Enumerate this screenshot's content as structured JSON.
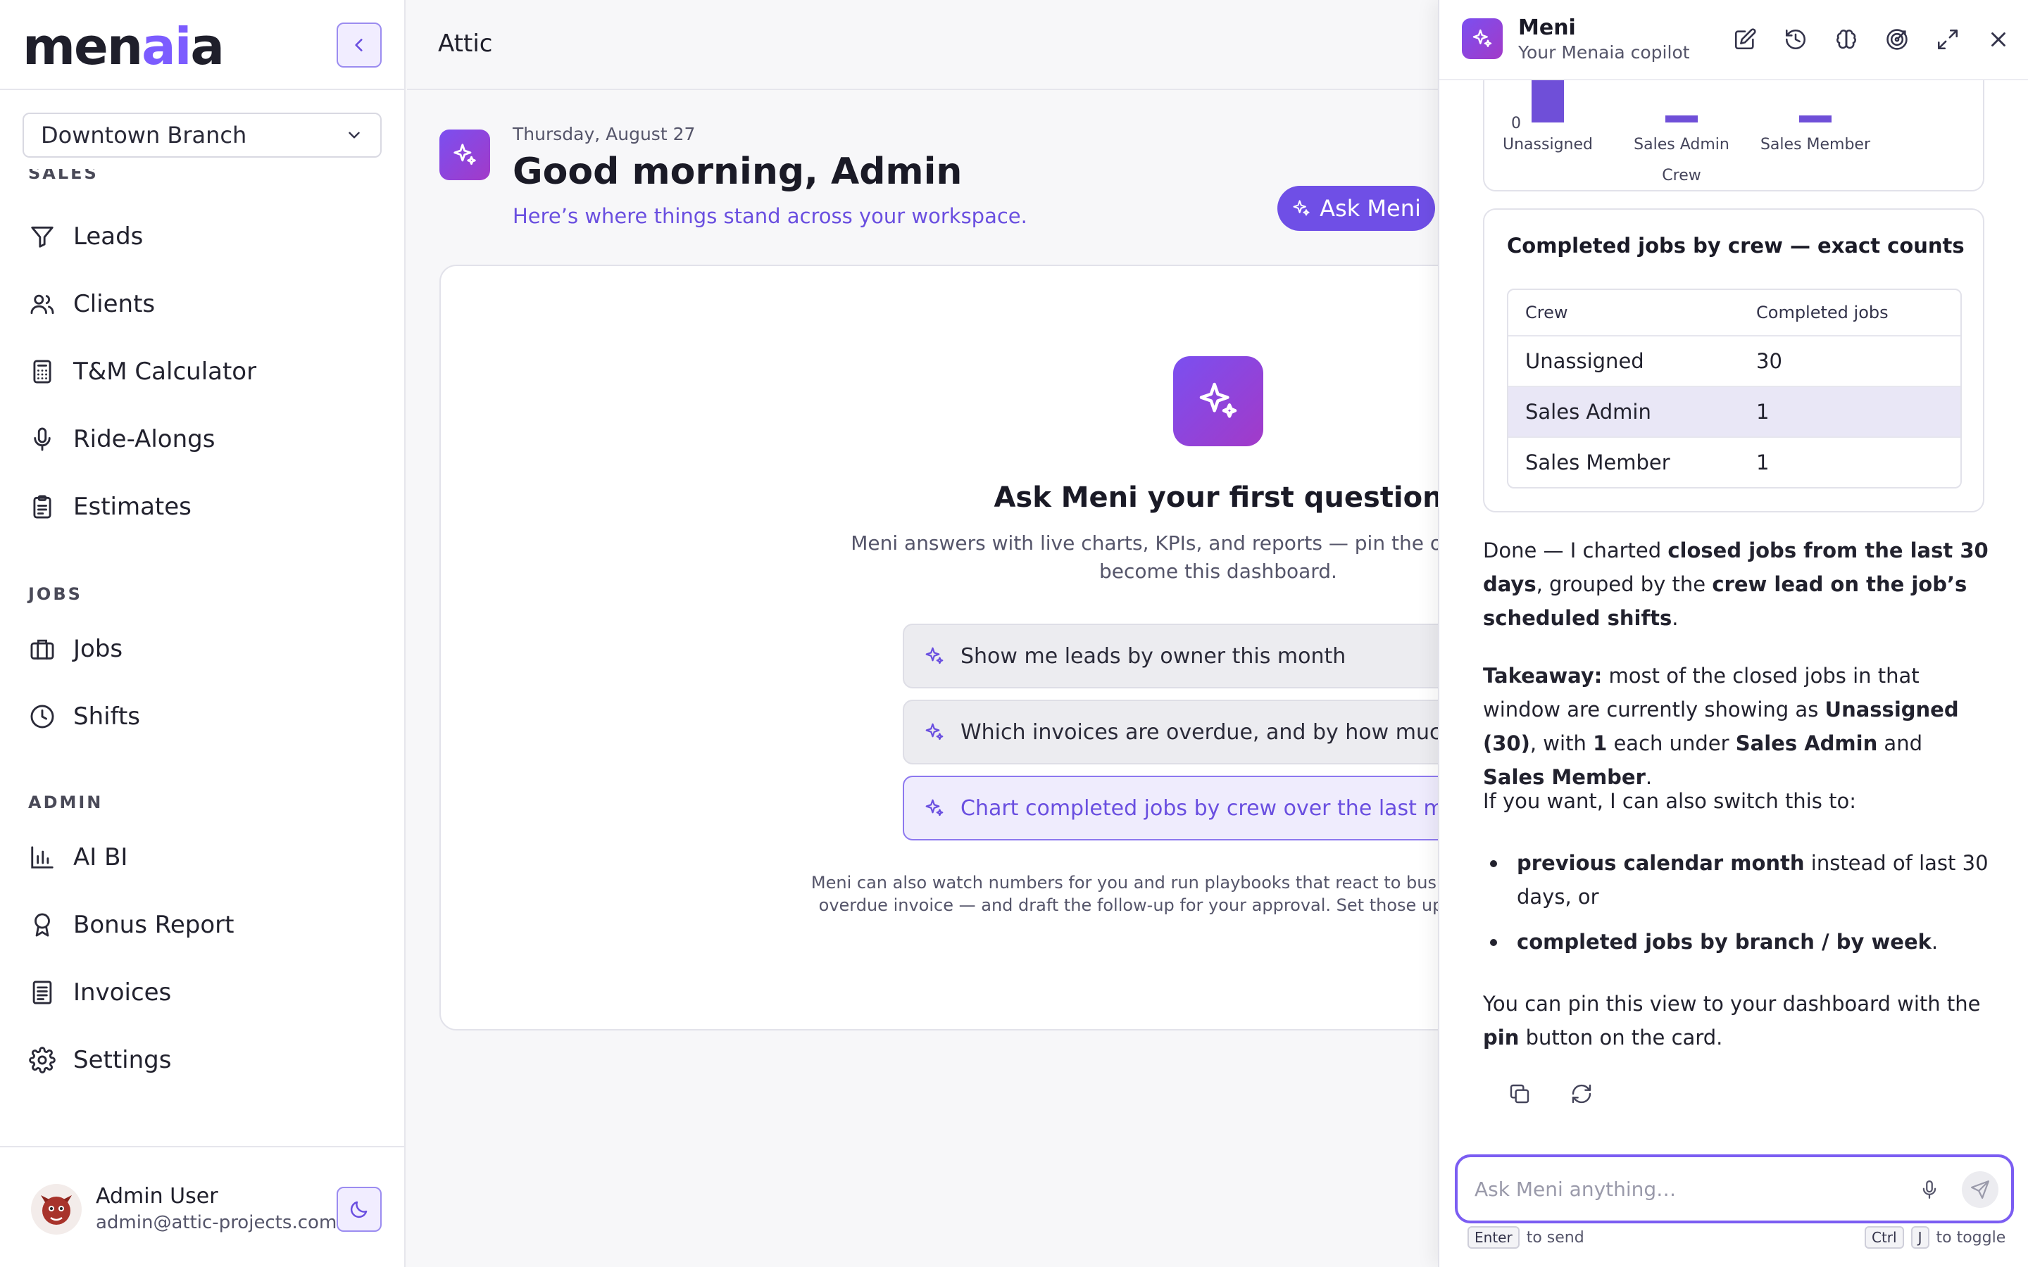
{
  "sidebar": {
    "logo_prefix": "men",
    "logo_accent": "ai",
    "logo_suffix": "a",
    "branch": "Downtown Branch",
    "sections": {
      "sales": "SALES",
      "jobs": "JOBS",
      "admin": "ADMIN"
    },
    "items": {
      "leads": "Leads",
      "clients": "Clients",
      "tm_calculator": "T&M Calculator",
      "ride_alongs": "Ride-Alongs",
      "estimates": "Estimates",
      "jobs": "Jobs",
      "shifts": "Shifts",
      "ai_bi": "AI BI",
      "bonus_report": "Bonus Report",
      "invoices": "Invoices",
      "settings": "Settings"
    },
    "user": {
      "name": "Admin User",
      "email": "admin@attic-projects.com"
    }
  },
  "topbar": {
    "breadcrumb": "Attic"
  },
  "main": {
    "date": "Thursday, August 27",
    "greeting": "Good morning, Admin",
    "subtitle": "Here’s where things stand across your workspace.",
    "ask_button": "Ask Meni",
    "card": {
      "title": "Ask Meni your first question",
      "description": "Meni answers with live charts, KPIs, and reports — pin the ones you like to become this dashboard.",
      "suggestions": [
        "Show me leads by owner this month",
        "Which invoices are overdue, and by how much?",
        "Chart completed jobs by crew over the last month"
      ],
      "footer": "Meni can also watch numbers for you and run playbooks that react to business events — like an overdue invoice — and draft the follow-up for your approval. Set those up from the AI BI page."
    }
  },
  "copilot": {
    "title": "Meni",
    "subtitle": "Your Menaia copilot",
    "chart_card": {
      "chart_data": {
        "type": "bar",
        "title": "",
        "categories": [
          "Unassigned",
          "Sales Admin",
          "Sales Member"
        ],
        "values": [
          30,
          1,
          1
        ],
        "xlabel": "Crew",
        "ylabel": "",
        "y_tick_visible": "0",
        "bar_color": "#6f4fd8"
      }
    },
    "table_card": {
      "title": "Completed jobs by crew — exact counts",
      "headers": [
        "Crew",
        "Completed jobs"
      ],
      "rows": [
        [
          "Unassigned",
          "30"
        ],
        [
          "Sales Admin",
          "1"
        ],
        [
          "Sales Member",
          "1"
        ]
      ]
    },
    "message": {
      "p1": {
        "a": "Done — I charted ",
        "b": "closed jobs from the last 30 days",
        "c": ", grouped by the ",
        "d": "crew lead on the job’s scheduled shifts",
        "e": "."
      },
      "p2": {
        "a": "Takeaway:",
        "b": " most of the closed jobs in that window are currently showing as ",
        "c": "Unassigned (30)",
        "d": ", with ",
        "e": "1",
        "f": " each under ",
        "g": "Sales Admin",
        "h": " and ",
        "i": "Sales Member",
        "j": "."
      },
      "p3": "If you want, I can also switch this to:",
      "b1": {
        "a": "previous calendar month",
        "b": " instead of last 30 days, or"
      },
      "b2": {
        "a": "completed jobs by branch / by week",
        "b": "."
      },
      "p4": {
        "a": "You can pin this view to your dashboard with the ",
        "b": "pin",
        "c": " button on the card."
      }
    },
    "input_placeholder": "Ask Meni anything…",
    "hint_send_key": "Enter",
    "hint_send": "to send",
    "hint_toggle_key1": "Ctrl",
    "hint_toggle_key2": "J",
    "hint_toggle": "to toggle"
  },
  "colors": {
    "accent": "#6f4fe6",
    "accent_light": "#f1edff",
    "gradient_start": "#7b4ff0",
    "gradient_end": "#a23ac8"
  }
}
